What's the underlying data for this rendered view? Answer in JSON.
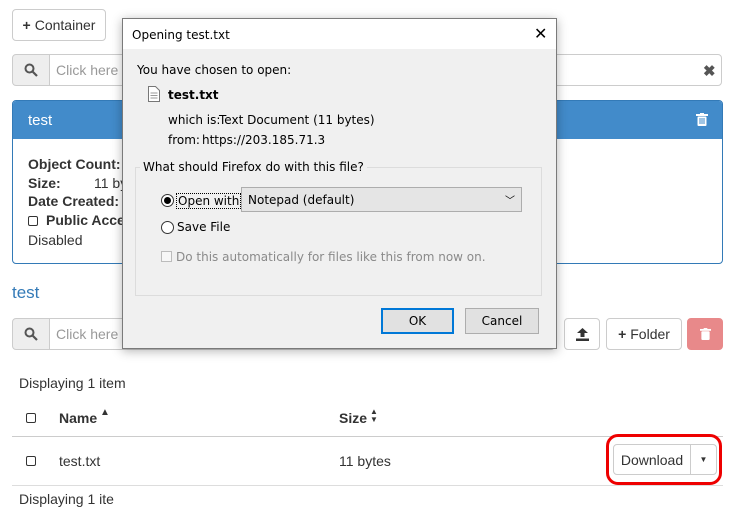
{
  "top": {
    "add_container_label": "Container",
    "search_placeholder": "Click here fo"
  },
  "panel": {
    "title": "test",
    "object_count_label": "Object Count:",
    "size_label": "Size:",
    "size_value": "11 by",
    "date_created_label": "Date Created:",
    "public_access_label": "Public Acces",
    "public_access_status": "Disabled"
  },
  "section": {
    "title": "test",
    "search_placeholder": "Click here fo",
    "folder_label": "Folder"
  },
  "listing": {
    "displaying": "Displaying 1 item",
    "col_name": "Name",
    "col_size": "Size",
    "rows": [
      {
        "name": "test.txt",
        "size": "11 bytes",
        "action": "Download"
      }
    ],
    "footer_partial": "Displaying 1 ite"
  },
  "dialog": {
    "title": "Opening test.txt",
    "intro": "You have chosen to open:",
    "filename": "test.txt",
    "which_is_label": "which is:",
    "which_is_value": "Text Document (11 bytes)",
    "from_label": "from:",
    "from_value": "https://203.185.71.3",
    "question": "What should Firefox do with this file?",
    "open_with_label": "Open with",
    "open_with_app": "Notepad (default)",
    "save_file_label": "Save File",
    "auto_label": "Do this automatically for files like this from now on.",
    "ok_label": "OK",
    "cancel_label": "Cancel"
  },
  "colors": {
    "primary": "#428bca",
    "danger": "#e8898a",
    "highlight": "#ee0000"
  }
}
